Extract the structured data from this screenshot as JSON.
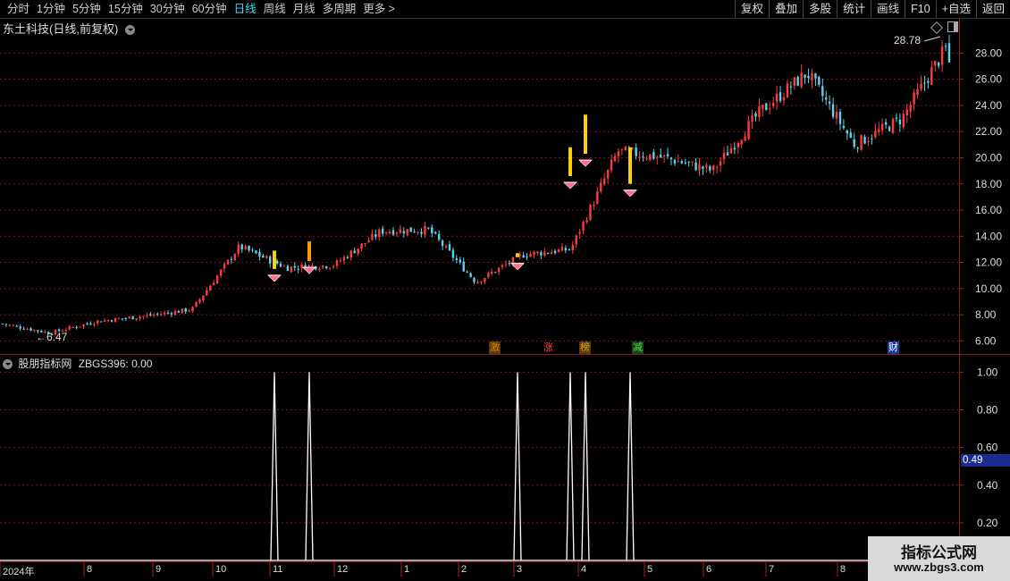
{
  "toolbar": {
    "tabs": [
      "分时",
      "1分钟",
      "5分钟",
      "15分钟",
      "30分钟",
      "60分钟",
      "日线",
      "周线",
      "月线",
      "多周期",
      "更多 >"
    ],
    "active_tab": "日线",
    "tools": [
      "复权",
      "叠加",
      "多股",
      "统计",
      "画线",
      "F10",
      "+自选",
      "返回"
    ]
  },
  "main_panel": {
    "title": "东土科技(日线,前复权)",
    "high_label": "28.78",
    "low_label": "6.47",
    "events": [
      {
        "text": "激",
        "color": "#e07a00",
        "bg": "#5a3a10"
      },
      {
        "text": "涨",
        "color": "#ff4040",
        "bg": "#000"
      },
      {
        "text": "榜",
        "color": "#e0a000",
        "bg": "#5a3a10"
      },
      {
        "text": "减",
        "color": "#40e040",
        "bg": "#204020"
      },
      {
        "text": "财",
        "color": "#ffffff",
        "bg": "#1a3aa0"
      }
    ]
  },
  "indicator_panel": {
    "title": "股朋指标网",
    "formula": "ZBGS396: 0.00",
    "current_value": "0.49"
  },
  "x_axis": {
    "labels": [
      "2024年",
      "8",
      "9",
      "10",
      "11",
      "12",
      "1",
      "2",
      "3",
      "4",
      "5",
      "6",
      "7",
      "8"
    ]
  },
  "watermark": {
    "title": "指标公式网",
    "url": "www.zbgs3.com"
  },
  "colors": {
    "up": "#ff3b3b",
    "down": "#5ad2f0",
    "signal_bar": "#ffd000",
    "signal_bar2": "#ff9900",
    "grid": "#7a1414",
    "indicator_line": "#ffffff"
  },
  "chart_data": [
    {
      "type": "candlestick",
      "title": "东土科技(日线,前复权)",
      "y_ticks": [
        6.0,
        8.0,
        10.0,
        12.0,
        14.0,
        16.0,
        18.0,
        20.0,
        22.0,
        24.0,
        26.0,
        28.0
      ],
      "ylim": [
        5.0,
        29.6
      ],
      "approx_close_path": [
        {
          "x": "2024-07",
          "y": 7.3
        },
        {
          "x": "2024-07-end",
          "y": 6.6
        },
        {
          "x": "2024-08",
          "y": 7.5
        },
        {
          "x": "2024-09",
          "y": 7.9
        },
        {
          "x": "2024-09-end",
          "y": 8.4
        },
        {
          "x": "2024-10",
          "y": 13.2
        },
        {
          "x": "2024-10-mid",
          "y": 11.6
        },
        {
          "x": "2024-11",
          "y": 11.8
        },
        {
          "x": "2024-11-mid",
          "y": 14.4
        },
        {
          "x": "2024-12",
          "y": 14.5
        },
        {
          "x": "2025-01",
          "y": 10.5
        },
        {
          "x": "2025-02",
          "y": 12.6
        },
        {
          "x": "2025-03",
          "y": 13.0
        },
        {
          "x": "2025-03-mid",
          "y": 20.5
        },
        {
          "x": "2025-04",
          "y": 20.0
        },
        {
          "x": "2025-04-mid",
          "y": 19.0
        },
        {
          "x": "2025-05",
          "y": 23.5
        },
        {
          "x": "2025-06",
          "y": 26.5
        },
        {
          "x": "2025-07",
          "y": 21.0
        },
        {
          "x": "2025-08",
          "y": 23.0
        },
        {
          "x": "2025-08-end",
          "y": 28.78
        }
      ],
      "signals_index": [
        1,
        2,
        3,
        4,
        5,
        6
      ],
      "high": 28.78,
      "low": 6.47
    },
    {
      "type": "line",
      "title": "ZBGS396",
      "y_ticks": [
        0.2,
        0.4,
        0.6,
        0.8,
        1.0
      ],
      "ylim": [
        0.0,
        1.04
      ],
      "signal_value": 1.0,
      "baseline_value": 0.0,
      "last_value": 0.0,
      "signals": 6
    }
  ]
}
